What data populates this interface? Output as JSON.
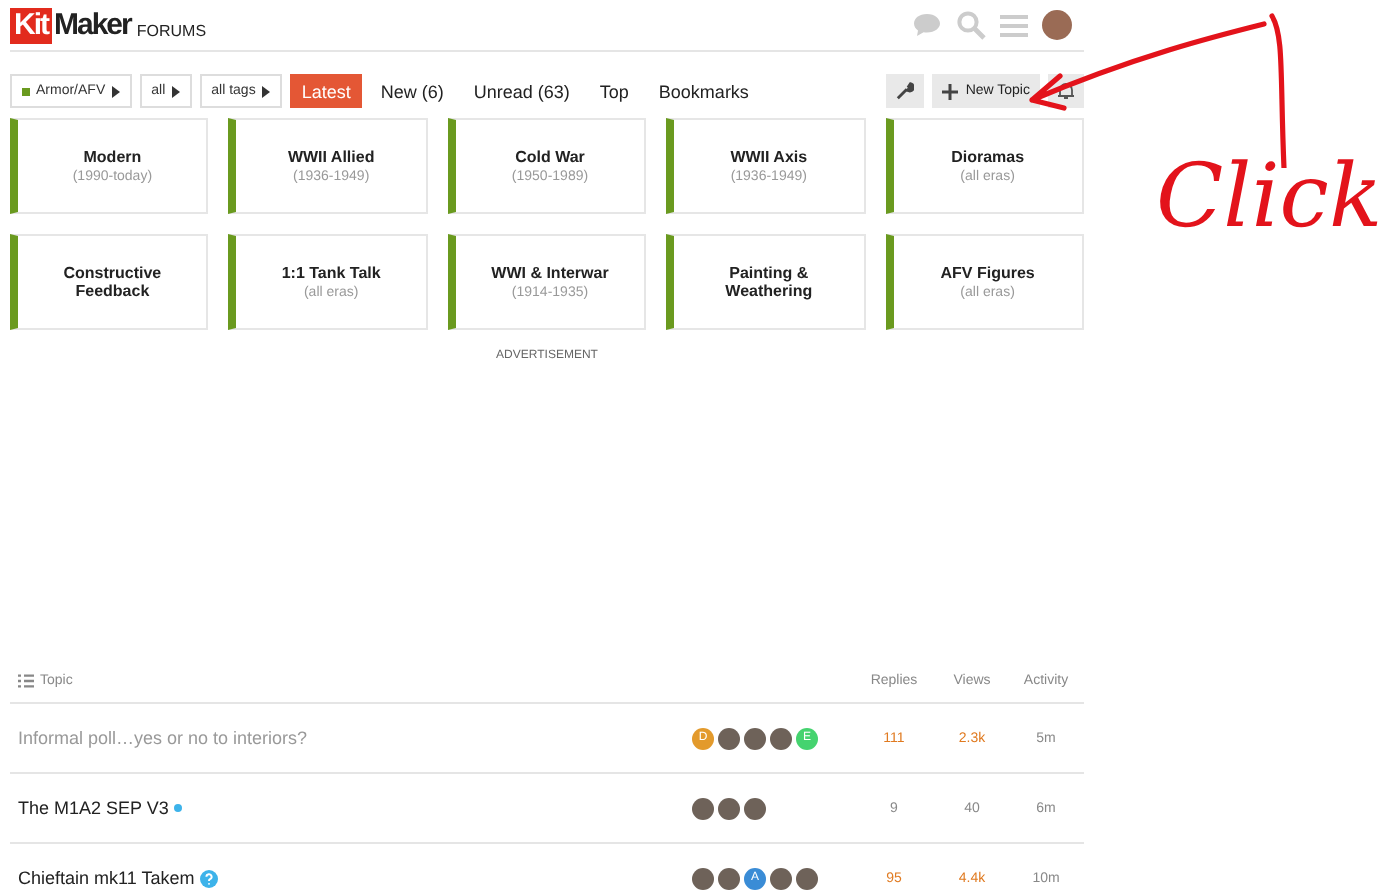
{
  "header": {
    "logo_kit": "Kit",
    "logo_maker": "Maker",
    "logo_sub": "FORUMS"
  },
  "filters": [
    {
      "label": "Armor/AFV",
      "color": "#6a9a1f"
    },
    {
      "label": "all"
    },
    {
      "label": "all tags"
    }
  ],
  "nav": [
    {
      "label": "Latest",
      "selected": true
    },
    {
      "label": "New (6)",
      "selected": false
    },
    {
      "label": "Unread (63)",
      "selected": false
    },
    {
      "label": "Top",
      "selected": false
    },
    {
      "label": "Bookmarks",
      "selected": false
    }
  ],
  "new_topic": "New Topic",
  "categories": [
    {
      "name": "Modern",
      "sub": "(1990-today)",
      "color": "#6a9a1f"
    },
    {
      "name": "WWII Allied",
      "sub": "(1936-1949)",
      "color": "#6a9a1f"
    },
    {
      "name": "Cold War",
      "sub": "(1950-1989)",
      "color": "#6a9a1f"
    },
    {
      "name": "WWII Axis",
      "sub": "(1936-1949)",
      "color": "#6a9a1f"
    },
    {
      "name": "Dioramas",
      "sub": "(all eras)",
      "color": "#6a9a1f"
    },
    {
      "name": "Constructive Feedback",
      "color": "#6a9a1f"
    },
    {
      "name": "1:1 Tank Talk",
      "sub": "(all eras)",
      "color": "#6a9a1f"
    },
    {
      "name": "WWI & Interwar",
      "sub": "(1914-1935)",
      "color": "#6a9a1f"
    },
    {
      "name": "Painting & Weathering",
      "color": "#6a9a1f"
    },
    {
      "name": "AFV Figures",
      "sub": "(all eras)",
      "color": "#6a9a1f"
    }
  ],
  "advertisement": "ADVERTISEMENT",
  "table": {
    "columns": [
      "Topic",
      "Replies",
      "Views",
      "Activity"
    ],
    "rows": [
      {
        "title": "Informal poll…yes or no to interiors?",
        "read": true,
        "unread_dot": false,
        "question": false,
        "avatars": [
          {
            "kind": "letter",
            "letter": "D",
            "color": "#e39a2c"
          },
          {
            "kind": "photo"
          },
          {
            "kind": "photo"
          },
          {
            "kind": "photo"
          },
          {
            "kind": "letter",
            "letter": "E",
            "color": "#45d36f"
          }
        ],
        "replies": "111",
        "views": "2.3k",
        "activity": "5m",
        "hot": true
      },
      {
        "title": "The M1A2 SEP V3",
        "read": false,
        "unread_dot": true,
        "question": false,
        "avatars": [
          {
            "kind": "photo"
          },
          {
            "kind": "photo"
          },
          {
            "kind": "photo"
          }
        ],
        "replies": "9",
        "views": "40",
        "activity": "6m",
        "hot": false
      },
      {
        "title": "Chieftain mk11 Takem",
        "read": false,
        "unread_dot": false,
        "question": true,
        "avatars": [
          {
            "kind": "photo"
          },
          {
            "kind": "photo"
          },
          {
            "kind": "letter",
            "letter": "A",
            "color": "#3a8cd6"
          },
          {
            "kind": "photo"
          },
          {
            "kind": "photo"
          }
        ],
        "replies": "95",
        "views": "4.4k",
        "activity": "10m",
        "hot": true
      }
    ]
  },
  "annotation": {
    "text": "Click"
  }
}
